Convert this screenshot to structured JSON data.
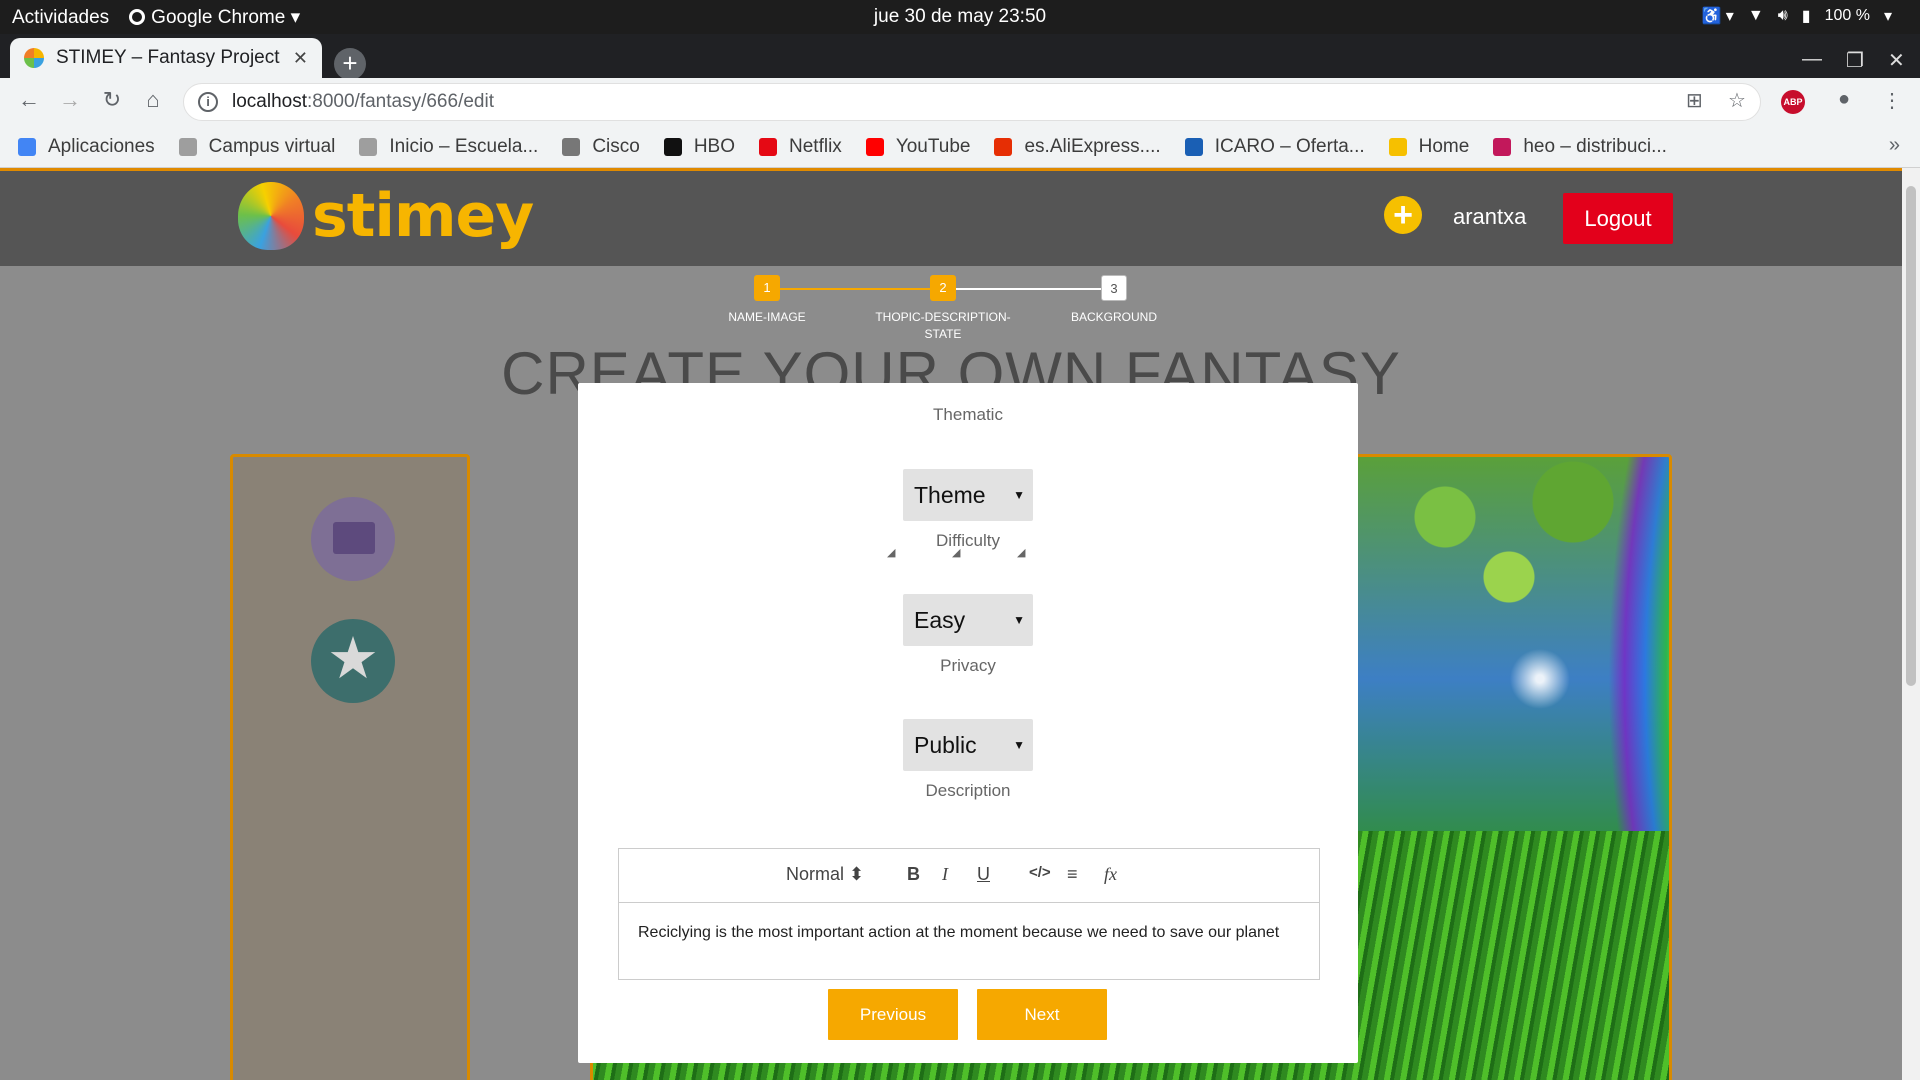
{
  "system_bar": {
    "activities": "Actividades",
    "app_name": "Google Chrome",
    "datetime": "jue 30 de may  23:50",
    "battery": "100 %"
  },
  "browser": {
    "tab_title": "STIMEY – Fantasy Project",
    "url_host": "localhost",
    "url_path": ":8000/fantasy/666/edit",
    "abp_label": "ABP",
    "bookmarks": [
      {
        "label": "Aplicaciones",
        "icon": "apps-grid-icon",
        "color": "#4285f4"
      },
      {
        "label": "Campus virtual",
        "icon": "campus-icon",
        "color": "#9e9e9e"
      },
      {
        "label": "Inicio – Escuela...",
        "icon": "school-icon",
        "color": "#9e9e9e"
      },
      {
        "label": "Cisco",
        "icon": "cisco-icon",
        "color": "#777777"
      },
      {
        "label": "HBO",
        "icon": "hbo-icon",
        "color": "#111111"
      },
      {
        "label": "Netflix",
        "icon": "netflix-icon",
        "color": "#e50914"
      },
      {
        "label": "YouTube",
        "icon": "youtube-icon",
        "color": "#ff0000"
      },
      {
        "label": "es.AliExpress....",
        "icon": "aliexpress-icon",
        "color": "#e62e04"
      },
      {
        "label": "ICARO – Oferta...",
        "icon": "icaro-icon",
        "color": "#1a5fb4"
      },
      {
        "label": "Home",
        "icon": "home-bookmark-icon",
        "color": "#f6c000"
      },
      {
        "label": "heo – distribuci...",
        "icon": "heo-icon",
        "color": "#c2185b"
      }
    ],
    "more_bookmarks": "»"
  },
  "site": {
    "logo_text": "stimey",
    "username": "arantxa",
    "logout_label": "Logout",
    "accent_color": "#f6a800"
  },
  "stepper": {
    "steps": [
      {
        "number": "1",
        "label": "NAME-IMAGE",
        "state": "active"
      },
      {
        "number": "2",
        "label": "THOPIC-DESCRIPTION-STATE",
        "state": "active"
      },
      {
        "number": "3",
        "label": "BACKGROUND",
        "state": "todo"
      }
    ]
  },
  "page_title": "CREATE YOUR OWN FANTASY",
  "form": {
    "thematic_label": "Thematic",
    "thematic_value": "Theme",
    "difficulty_label": "Difficulty",
    "difficulty_value": "Easy",
    "privacy_label": "Privacy",
    "privacy_value": "Public",
    "description_label": "Description",
    "editor": {
      "format_value": "Normal",
      "bold": "B",
      "italic": "I",
      "underline": "U",
      "code": "</>",
      "align": "≡",
      "clear": "fx",
      "content": "Reciclying is the most important action at the moment because we need to save our planet"
    },
    "previous_label": "Previous",
    "next_label": "Next"
  }
}
